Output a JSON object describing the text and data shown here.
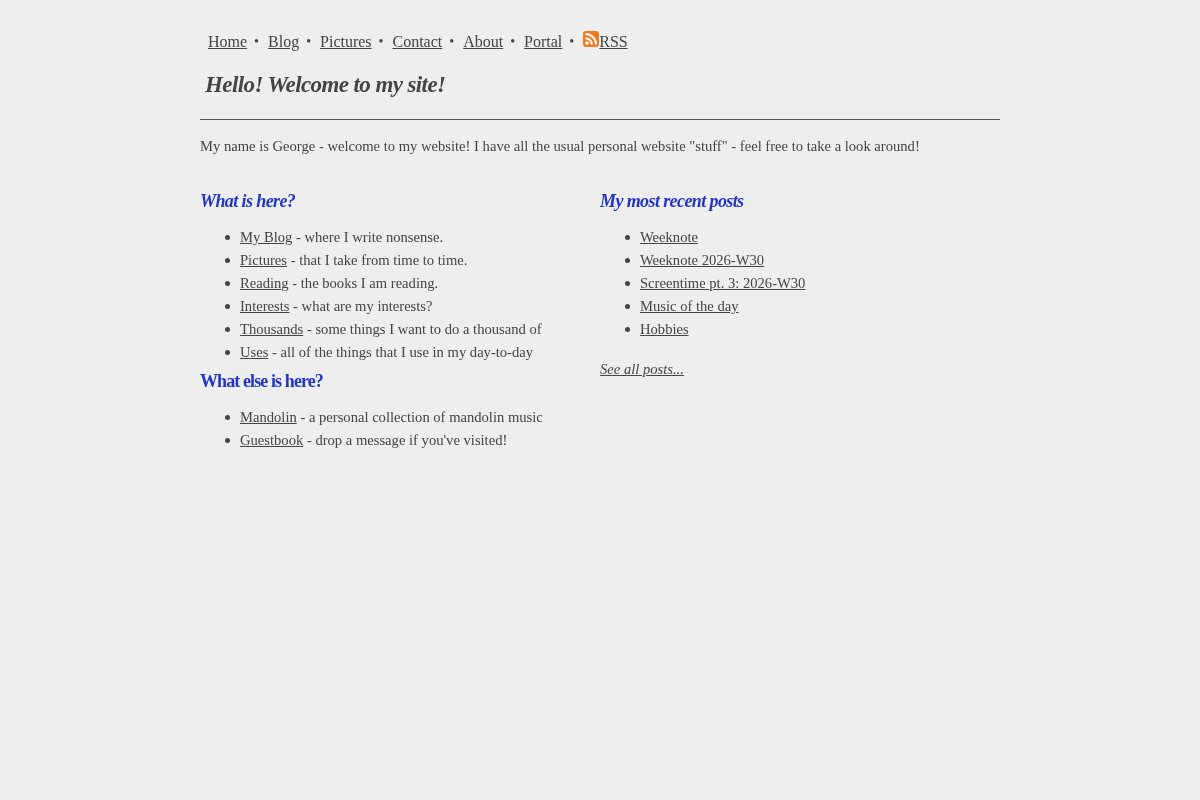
{
  "nav": [
    {
      "kind": "link",
      "label": "Home",
      "separator": "•"
    },
    {
      "kind": "link",
      "label": "Blog",
      "separator": "•"
    },
    {
      "kind": "link",
      "label": "Pictures",
      "separator": "•"
    },
    {
      "kind": "link",
      "label": "Contact",
      "separator": "•"
    },
    {
      "kind": "link",
      "label": "About",
      "separator": "•"
    },
    {
      "kind": "link",
      "label": "Portal",
      "separator": "•"
    },
    {
      "kind": "feed",
      "label": "RSS"
    }
  ],
  "title": "Hello! Welcome to my site!",
  "intro": "My name is George - welcome to my website! I have all the usual personal website \"stuff\" - feel free to take a look around!",
  "columns": [
    {
      "sections": [
        {
          "heading": "What is here?",
          "italic": true,
          "items": [
            {
              "link": "My Blog",
              "description": "- where I write nonsense."
            },
            {
              "link": "Pictures",
              "description": "- that I take from time to time."
            },
            {
              "link": "Reading",
              "description": "- the books I am reading."
            },
            {
              "link": "Interests",
              "description": "- what are my interests?"
            },
            {
              "link": "Thousands",
              "description": "- some things I want to do a thousand of"
            },
            {
              "link": "Uses",
              "description": "- all of the things that I use in my day-to-day"
            }
          ]
        },
        {
          "heading": "What else is here?",
          "italic": false,
          "items": [
            {
              "link": "Mandolin",
              "description": "- a personal collection of mandolin music"
            },
            {
              "link": "Guestbook",
              "description": "- drop a message if you've visited!"
            }
          ]
        }
      ]
    },
    {
      "sections": [
        {
          "heading": "My most recent posts",
          "italic": true,
          "items": [
            {
              "link": "Weeknote"
            },
            {
              "link": "Weeknote 2026-W30"
            },
            {
              "link": "Screentime pt. 3: 2026-W30"
            },
            {
              "link": "Music of the day"
            },
            {
              "link": "Hobbies"
            }
          ]
        }
      ],
      "footer_link": "See all posts..."
    }
  ]
}
